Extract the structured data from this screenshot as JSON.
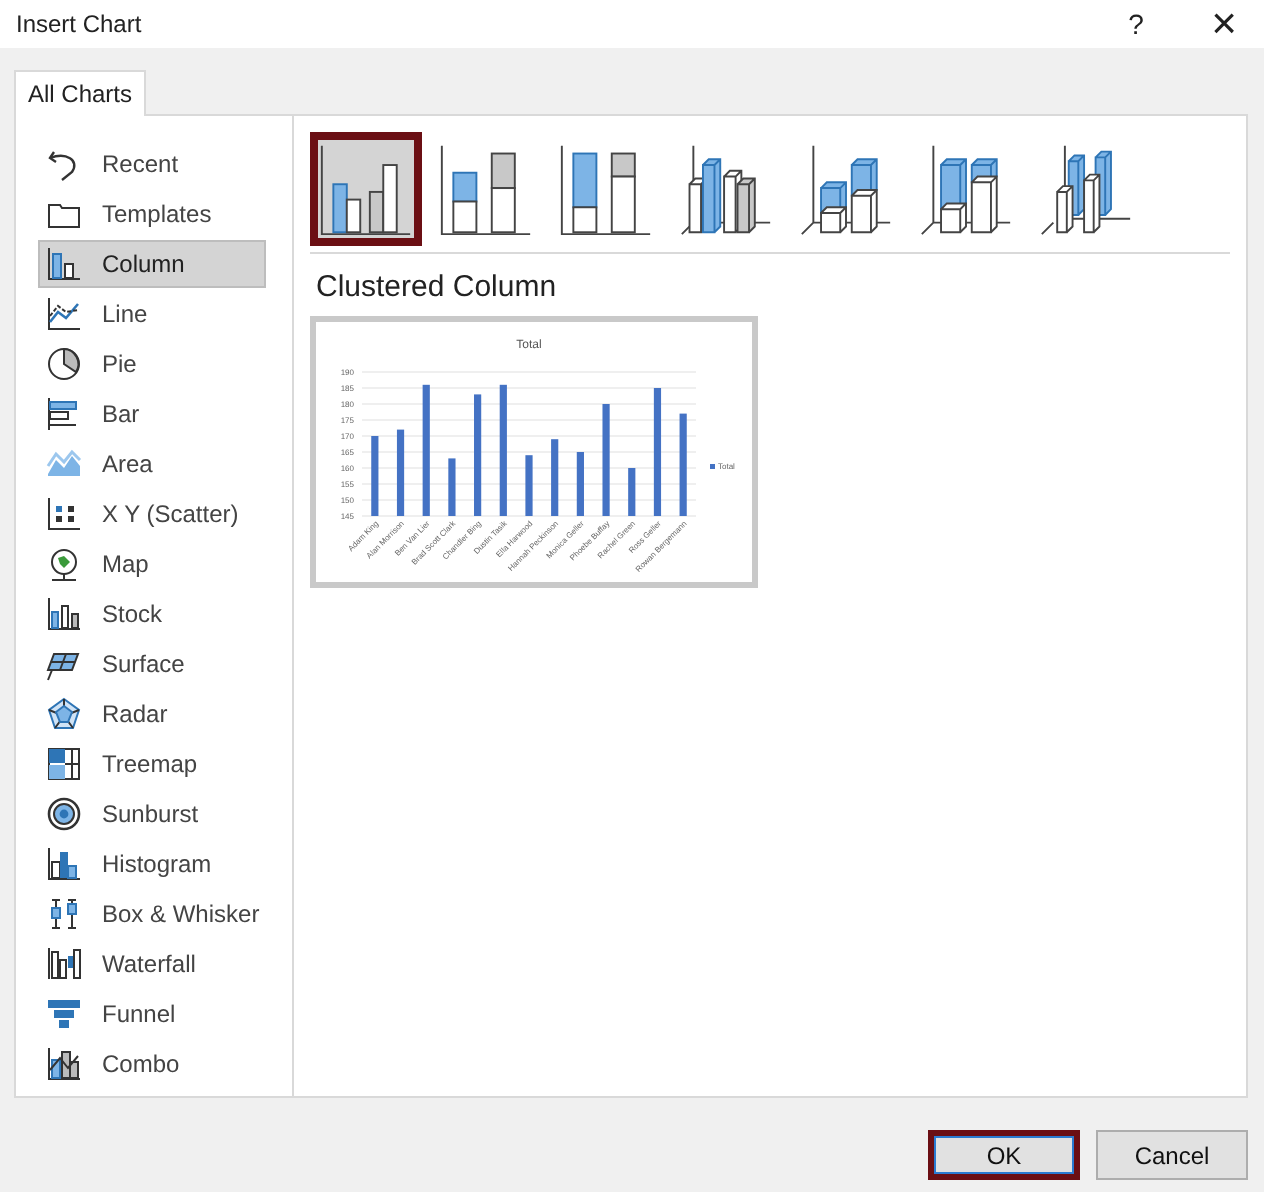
{
  "window": {
    "title": "Insert Chart",
    "help": "?",
    "close": "×"
  },
  "tabs": [
    {
      "label": "All Charts",
      "selected": true
    }
  ],
  "sidebar": {
    "items": [
      {
        "label": "Recent",
        "selected": false
      },
      {
        "label": "Templates",
        "selected": false
      },
      {
        "label": "Column",
        "selected": true
      },
      {
        "label": "Line",
        "selected": false
      },
      {
        "label": "Pie",
        "selected": false
      },
      {
        "label": "Bar",
        "selected": false
      },
      {
        "label": "Area",
        "selected": false
      },
      {
        "label": "X Y (Scatter)",
        "selected": false
      },
      {
        "label": "Map",
        "selected": false
      },
      {
        "label": "Stock",
        "selected": false
      },
      {
        "label": "Surface",
        "selected": false
      },
      {
        "label": "Radar",
        "selected": false
      },
      {
        "label": "Treemap",
        "selected": false
      },
      {
        "label": "Sunburst",
        "selected": false
      },
      {
        "label": "Histogram",
        "selected": false
      },
      {
        "label": "Box & Whisker",
        "selected": false
      },
      {
        "label": "Waterfall",
        "selected": false
      },
      {
        "label": "Funnel",
        "selected": false
      },
      {
        "label": "Combo",
        "selected": false
      }
    ]
  },
  "subtypes": [
    {
      "selected": true
    },
    {
      "selected": false
    },
    {
      "selected": false
    },
    {
      "selected": false
    },
    {
      "selected": false
    },
    {
      "selected": false
    },
    {
      "selected": false
    }
  ],
  "preview": {
    "heading": "Clustered Column",
    "chart_data": {
      "type": "bar",
      "title": "Total",
      "categories": [
        "Adam King",
        "Alan Morrison",
        "Ben Van Lier",
        "Brad Scott Clark",
        "Chandler Bing",
        "Dustin Tasik",
        "Ella Harwood",
        "Hannah Peckinson",
        "Monica Geller",
        "Phoebe Buffay",
        "Rachel Green",
        "Ross Geller",
        "Rowan Bergemann"
      ],
      "series": [
        {
          "name": "Total",
          "color": "#4472c4",
          "values": [
            170,
            172,
            186,
            163,
            183,
            186,
            164,
            169,
            165,
            180,
            160,
            185,
            177
          ]
        }
      ],
      "grid": true,
      "ylim": [
        145,
        190
      ],
      "yticks": [
        145,
        150,
        155,
        160,
        165,
        170,
        175,
        180,
        185,
        190
      ]
    }
  },
  "buttons": [
    {
      "label": "OK",
      "kind": "primary"
    },
    {
      "label": "Cancel",
      "kind": "normal"
    }
  ]
}
